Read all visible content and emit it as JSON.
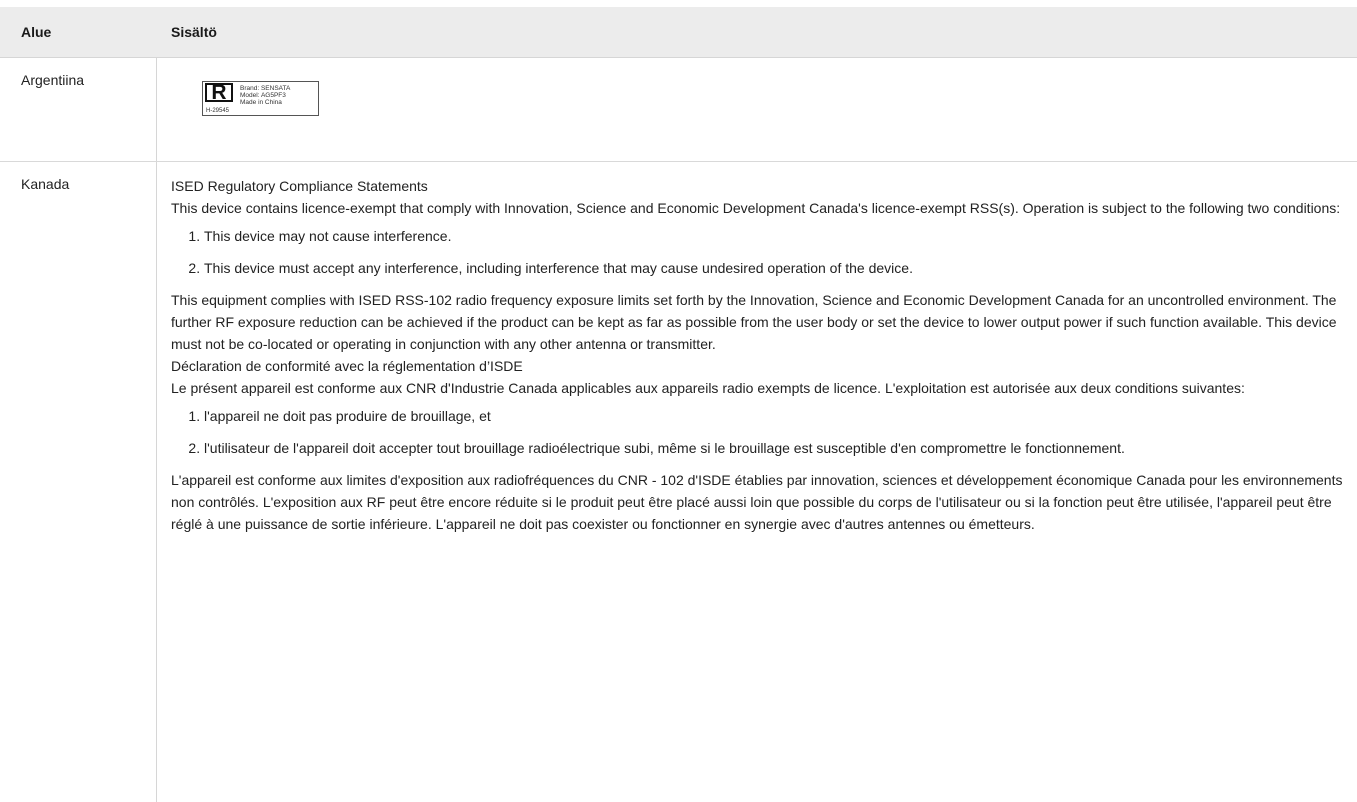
{
  "table": {
    "headers": {
      "region": "Alue",
      "content": "Sisältö"
    },
    "argentina": {
      "region": "Argentiina",
      "label": {
        "mark": "R",
        "lines": [
          "Brand: SENSATA",
          "Model: AG5PF3",
          "Made in China"
        ],
        "code": "H-29545"
      }
    },
    "canada": {
      "region": "Kanada",
      "en_title": "ISED Regulatory Compliance Statements",
      "en_intro": "This device contains licence-exempt that comply with Innovation, Science and Economic Development Canada's licence-exempt RSS(s). Operation is subject to the following two conditions:",
      "en_conditions": [
        "This device may not cause interference.",
        "This device must accept any interference, including interference that may cause undesired operation of the device."
      ],
      "en_rf": "This equipment complies with ISED RSS-102 radio frequency exposure limits set forth by the Innovation, Science and Economic Development Canada for an uncontrolled environment. The further RF exposure reduction can be achieved if the product can be kept as far as possible from the user body or set the device to lower output power if such function available. This device must not be co-located or operating in conjunction with any other antenna or transmitter.",
      "fr_title": "Déclaration de conformité avec la réglementation d’ISDE",
      "fr_intro": "Le présent appareil est conforme aux CNR d'Industrie Canada applicables aux appareils radio exempts de licence. L'exploitation est autorisée aux deux conditions suivantes:",
      "fr_conditions": [
        "l'appareil ne doit pas produire de brouillage, et",
        "l'utilisateur de l'appareil doit accepter tout brouillage radioélectrique subi, même si le brouillage est susceptible d'en compromettre le fonctionnement."
      ],
      "fr_rf": "L'appareil est conforme aux limites d'exposition aux radiofréquences du CNR - 102 d'ISDE établies par innovation, sciences et développement économique Canada pour les environnements non contrôlés. L'exposition aux RF peut être encore réduite si le produit peut être placé aussi loin que possible du corps de l'utilisateur ou si la fonction peut être utilisée, l'appareil peut être réglé à une puissance de sortie inférieure. L'appareil ne doit pas coexister ou fonctionner en synergie avec d'autres antennes ou émetteurs."
    }
  }
}
